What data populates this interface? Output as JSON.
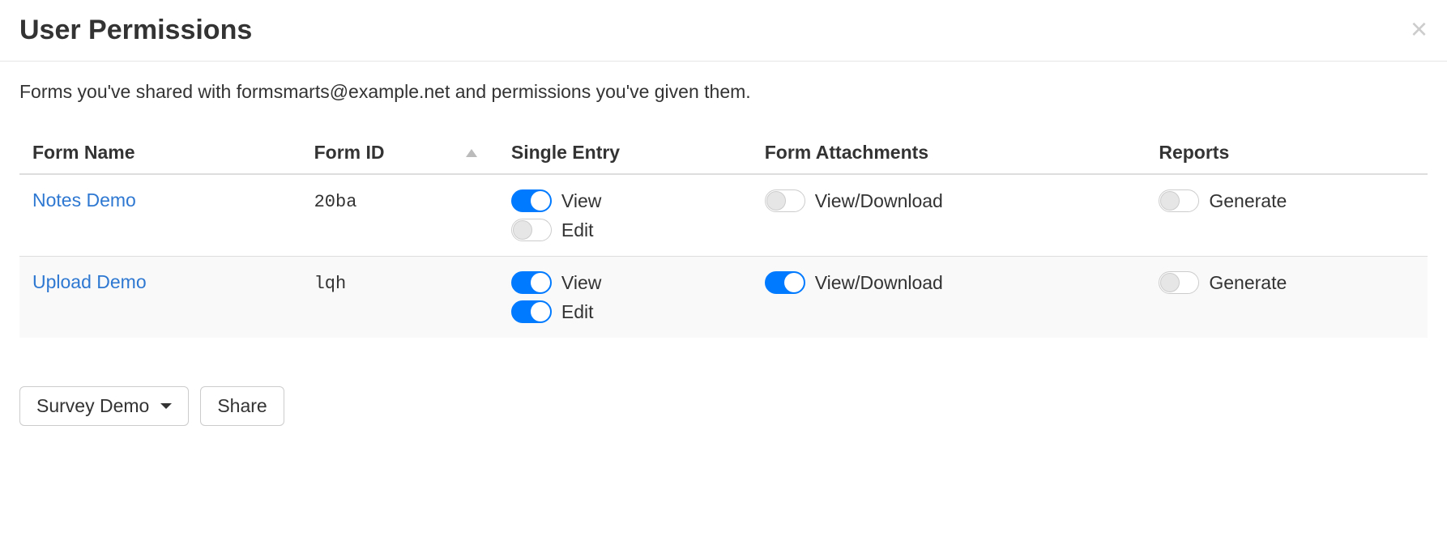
{
  "header": {
    "title": "User Permissions"
  },
  "description": "Forms you've shared with formsmarts@example.net and permissions you've given them.",
  "table": {
    "columns": {
      "name": "Form Name",
      "id": "Form ID",
      "single": "Single Entry",
      "attach": "Form Attachments",
      "reports": "Reports"
    },
    "labels": {
      "view": "View",
      "edit": "Edit",
      "view_download": "View/Download",
      "generate": "Generate"
    },
    "rows": [
      {
        "name": "Notes Demo",
        "id": "20ba",
        "single_view": true,
        "single_edit": false,
        "attach": false,
        "reports": false
      },
      {
        "name": "Upload Demo",
        "id": "lqh",
        "single_view": true,
        "single_edit": true,
        "attach": true,
        "reports": false
      }
    ]
  },
  "footer": {
    "dropdown_label": "Survey Demo",
    "share_label": "Share"
  }
}
